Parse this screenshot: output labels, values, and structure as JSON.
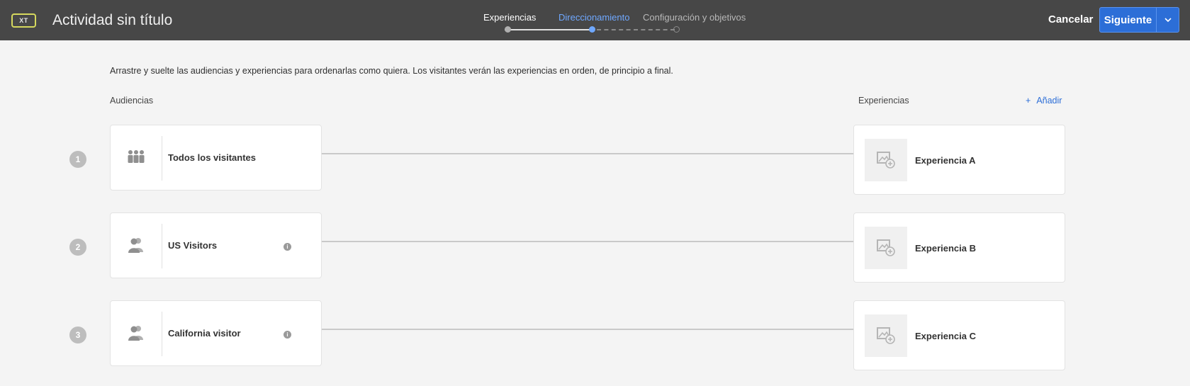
{
  "header": {
    "badge": "XT",
    "title": "Actividad sin título",
    "steps": [
      {
        "label": "Experiencias",
        "state": "done"
      },
      {
        "label": "Direccionamiento",
        "state": "active"
      },
      {
        "label": "Configuración y objetivos",
        "state": "todo"
      }
    ],
    "cancel_label": "Cancelar",
    "next_label": "Siguiente"
  },
  "main": {
    "instructions": "Arrastre y suelte las audiencias y experiencias para ordenarlas como quiera. Los visitantes verán las experiencias en orden, de principio a final.",
    "audiences_label": "Audiencias",
    "experiences_label": "Experiencias",
    "add_label": "Añadir",
    "rows": [
      {
        "number": "1",
        "audience": "Todos los visitantes",
        "audience_icon": "group-icon",
        "has_info": false,
        "experience": "Experiencia A"
      },
      {
        "number": "2",
        "audience": "US Visitors",
        "audience_icon": "users-icon",
        "has_info": true,
        "experience": "Experiencia B"
      },
      {
        "number": "3",
        "audience": "California visitor",
        "audience_icon": "users-icon",
        "has_info": true,
        "experience": "Experiencia C"
      }
    ]
  },
  "colors": {
    "header_bg": "#474747",
    "accent": "#2c6ed7",
    "active_step": "#6fa8ff",
    "badge_border": "#d6d95e"
  }
}
